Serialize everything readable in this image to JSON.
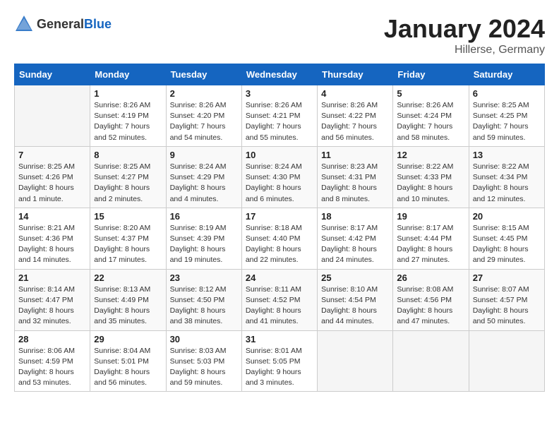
{
  "header": {
    "logo_general": "General",
    "logo_blue": "Blue",
    "month": "January 2024",
    "location": "Hillerse, Germany"
  },
  "days_of_week": [
    "Sunday",
    "Monday",
    "Tuesday",
    "Wednesday",
    "Thursday",
    "Friday",
    "Saturday"
  ],
  "weeks": [
    [
      {
        "day": "",
        "sunrise": "",
        "sunset": "",
        "daylight": ""
      },
      {
        "day": "1",
        "sunrise": "Sunrise: 8:26 AM",
        "sunset": "Sunset: 4:19 PM",
        "daylight": "Daylight: 7 hours and 52 minutes."
      },
      {
        "day": "2",
        "sunrise": "Sunrise: 8:26 AM",
        "sunset": "Sunset: 4:20 PM",
        "daylight": "Daylight: 7 hours and 54 minutes."
      },
      {
        "day": "3",
        "sunrise": "Sunrise: 8:26 AM",
        "sunset": "Sunset: 4:21 PM",
        "daylight": "Daylight: 7 hours and 55 minutes."
      },
      {
        "day": "4",
        "sunrise": "Sunrise: 8:26 AM",
        "sunset": "Sunset: 4:22 PM",
        "daylight": "Daylight: 7 hours and 56 minutes."
      },
      {
        "day": "5",
        "sunrise": "Sunrise: 8:26 AM",
        "sunset": "Sunset: 4:24 PM",
        "daylight": "Daylight: 7 hours and 58 minutes."
      },
      {
        "day": "6",
        "sunrise": "Sunrise: 8:25 AM",
        "sunset": "Sunset: 4:25 PM",
        "daylight": "Daylight: 7 hours and 59 minutes."
      }
    ],
    [
      {
        "day": "7",
        "sunrise": "Sunrise: 8:25 AM",
        "sunset": "Sunset: 4:26 PM",
        "daylight": "Daylight: 8 hours and 1 minute."
      },
      {
        "day": "8",
        "sunrise": "Sunrise: 8:25 AM",
        "sunset": "Sunset: 4:27 PM",
        "daylight": "Daylight: 8 hours and 2 minutes."
      },
      {
        "day": "9",
        "sunrise": "Sunrise: 8:24 AM",
        "sunset": "Sunset: 4:29 PM",
        "daylight": "Daylight: 8 hours and 4 minutes."
      },
      {
        "day": "10",
        "sunrise": "Sunrise: 8:24 AM",
        "sunset": "Sunset: 4:30 PM",
        "daylight": "Daylight: 8 hours and 6 minutes."
      },
      {
        "day": "11",
        "sunrise": "Sunrise: 8:23 AM",
        "sunset": "Sunset: 4:31 PM",
        "daylight": "Daylight: 8 hours and 8 minutes."
      },
      {
        "day": "12",
        "sunrise": "Sunrise: 8:22 AM",
        "sunset": "Sunset: 4:33 PM",
        "daylight": "Daylight: 8 hours and 10 minutes."
      },
      {
        "day": "13",
        "sunrise": "Sunrise: 8:22 AM",
        "sunset": "Sunset: 4:34 PM",
        "daylight": "Daylight: 8 hours and 12 minutes."
      }
    ],
    [
      {
        "day": "14",
        "sunrise": "Sunrise: 8:21 AM",
        "sunset": "Sunset: 4:36 PM",
        "daylight": "Daylight: 8 hours and 14 minutes."
      },
      {
        "day": "15",
        "sunrise": "Sunrise: 8:20 AM",
        "sunset": "Sunset: 4:37 PM",
        "daylight": "Daylight: 8 hours and 17 minutes."
      },
      {
        "day": "16",
        "sunrise": "Sunrise: 8:19 AM",
        "sunset": "Sunset: 4:39 PM",
        "daylight": "Daylight: 8 hours and 19 minutes."
      },
      {
        "day": "17",
        "sunrise": "Sunrise: 8:18 AM",
        "sunset": "Sunset: 4:40 PM",
        "daylight": "Daylight: 8 hours and 22 minutes."
      },
      {
        "day": "18",
        "sunrise": "Sunrise: 8:17 AM",
        "sunset": "Sunset: 4:42 PM",
        "daylight": "Daylight: 8 hours and 24 minutes."
      },
      {
        "day": "19",
        "sunrise": "Sunrise: 8:17 AM",
        "sunset": "Sunset: 4:44 PM",
        "daylight": "Daylight: 8 hours and 27 minutes."
      },
      {
        "day": "20",
        "sunrise": "Sunrise: 8:15 AM",
        "sunset": "Sunset: 4:45 PM",
        "daylight": "Daylight: 8 hours and 29 minutes."
      }
    ],
    [
      {
        "day": "21",
        "sunrise": "Sunrise: 8:14 AM",
        "sunset": "Sunset: 4:47 PM",
        "daylight": "Daylight: 8 hours and 32 minutes."
      },
      {
        "day": "22",
        "sunrise": "Sunrise: 8:13 AM",
        "sunset": "Sunset: 4:49 PM",
        "daylight": "Daylight: 8 hours and 35 minutes."
      },
      {
        "day": "23",
        "sunrise": "Sunrise: 8:12 AM",
        "sunset": "Sunset: 4:50 PM",
        "daylight": "Daylight: 8 hours and 38 minutes."
      },
      {
        "day": "24",
        "sunrise": "Sunrise: 8:11 AM",
        "sunset": "Sunset: 4:52 PM",
        "daylight": "Daylight: 8 hours and 41 minutes."
      },
      {
        "day": "25",
        "sunrise": "Sunrise: 8:10 AM",
        "sunset": "Sunset: 4:54 PM",
        "daylight": "Daylight: 8 hours and 44 minutes."
      },
      {
        "day": "26",
        "sunrise": "Sunrise: 8:08 AM",
        "sunset": "Sunset: 4:56 PM",
        "daylight": "Daylight: 8 hours and 47 minutes."
      },
      {
        "day": "27",
        "sunrise": "Sunrise: 8:07 AM",
        "sunset": "Sunset: 4:57 PM",
        "daylight": "Daylight: 8 hours and 50 minutes."
      }
    ],
    [
      {
        "day": "28",
        "sunrise": "Sunrise: 8:06 AM",
        "sunset": "Sunset: 4:59 PM",
        "daylight": "Daylight: 8 hours and 53 minutes."
      },
      {
        "day": "29",
        "sunrise": "Sunrise: 8:04 AM",
        "sunset": "Sunset: 5:01 PM",
        "daylight": "Daylight: 8 hours and 56 minutes."
      },
      {
        "day": "30",
        "sunrise": "Sunrise: 8:03 AM",
        "sunset": "Sunset: 5:03 PM",
        "daylight": "Daylight: 8 hours and 59 minutes."
      },
      {
        "day": "31",
        "sunrise": "Sunrise: 8:01 AM",
        "sunset": "Sunset: 5:05 PM",
        "daylight": "Daylight: 9 hours and 3 minutes."
      },
      {
        "day": "",
        "sunrise": "",
        "sunset": "",
        "daylight": ""
      },
      {
        "day": "",
        "sunrise": "",
        "sunset": "",
        "daylight": ""
      },
      {
        "day": "",
        "sunrise": "",
        "sunset": "",
        "daylight": ""
      }
    ]
  ]
}
